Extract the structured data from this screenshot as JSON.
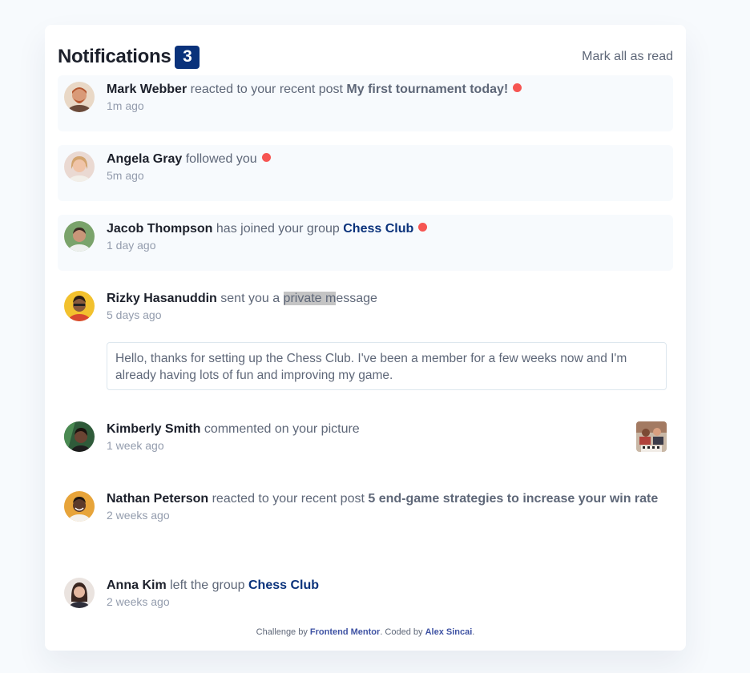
{
  "header": {
    "title": "Notifications",
    "badge_count": "3",
    "mark_all_label": "Mark all as read"
  },
  "notifications": [
    {
      "name": "Mark Webber",
      "action": "reacted to your recent post",
      "target": "My first tournament today!",
      "time": "1m ago",
      "unread": true
    },
    {
      "name": "Angela Gray",
      "action": "followed you",
      "time": "5m ago",
      "unread": true
    },
    {
      "name": "Jacob Thompson",
      "action": "has joined your group",
      "target": "Chess Club",
      "time": "1 day ago",
      "unread": true
    },
    {
      "name": "Rizky Hasanuddin",
      "action_pre": "sent you a",
      "action_highlight": "private m",
      "action_post": "essage",
      "time": "5 days ago",
      "message": "Hello, thanks for setting up the Chess Club. I've been a member for a few weeks now and I'm already having lots of fun and improving my game.",
      "unread": false
    },
    {
      "name": "Kimberly Smith",
      "action": "commented on your picture",
      "time": "1 week ago",
      "unread": false
    },
    {
      "name": "Nathan Peterson",
      "action": "reacted to your recent post",
      "target": "5 end-game strategies to increase your win rate",
      "time": "2 weeks ago",
      "unread": false
    },
    {
      "name": "Anna Kim",
      "action": "left the group",
      "target": "Chess Club",
      "time": "2 weeks ago",
      "unread": false
    }
  ],
  "footer": {
    "prefix": "Challenge by",
    "link1": "Frontend Mentor",
    "middle": ". Coded by",
    "link2": "Alex Sincai",
    "suffix": "."
  },
  "colors": {
    "accent": "#0a327b",
    "unread_dot": "#f65552",
    "unread_bg": "#f7fafd"
  }
}
